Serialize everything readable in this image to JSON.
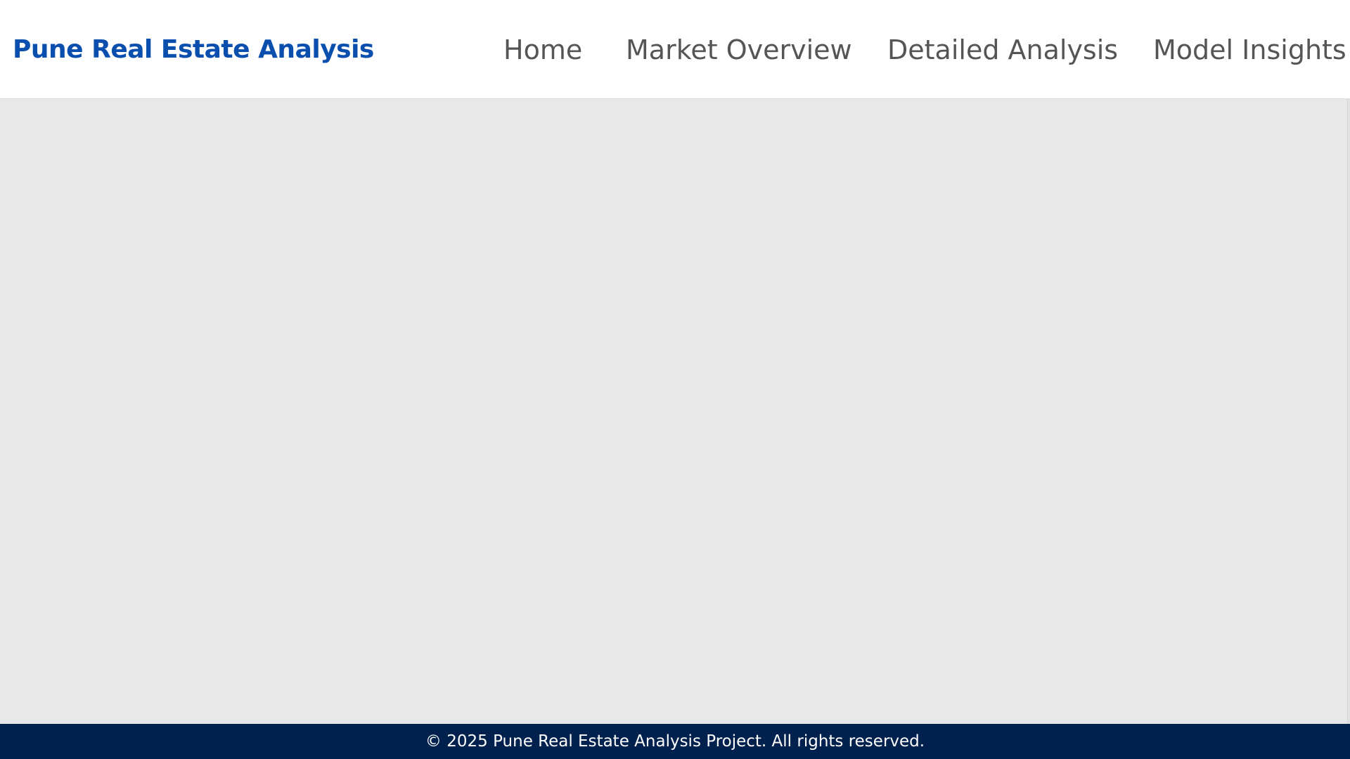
{
  "header": {
    "brand": "Pune Real Estate Analysis",
    "nav": [
      {
        "label": "Home"
      },
      {
        "label": "Market Overview"
      },
      {
        "label": "Detailed Analysis"
      },
      {
        "label": "Model Insights"
      }
    ]
  },
  "footer": {
    "text": "© 2025 Pune Real Estate Analysis Project. All rights reserved."
  },
  "colors": {
    "brand": "#0a4fae",
    "nav_text": "#555555",
    "content_background": "#e8e8e8",
    "footer_background": "#00214d",
    "footer_text": "#ffffff"
  }
}
